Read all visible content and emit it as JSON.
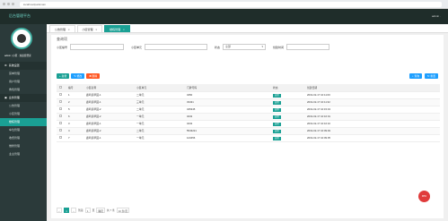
{
  "browser": {
    "url": "localhost/parkmain"
  },
  "header": {
    "logo": "后台管理平台",
    "user": "admin ·"
  },
  "sidebar": {
    "user_line": "admin | 小区 · 欢迎您登录",
    "groups": [
      {
        "label": "系统设置",
        "items": [
          "菜单管理",
          "用户管理",
          "角色管理"
        ]
      },
      {
        "label": "业务管理",
        "items": [
          "公告管理",
          "小区管理",
          "楼栋管理",
          "车位管理",
          "收费管理",
          "维修管理",
          "业主管理"
        ]
      }
    ],
    "active_item": "楼栋管理"
  },
  "tabs": [
    {
      "label": "公告管理",
      "active": false
    },
    {
      "label": "小区管理",
      "active": false
    },
    {
      "label": "楼栋管理",
      "active": true
    }
  ],
  "panel": {
    "title": "查询项",
    "search": {
      "f1_label": "小区编号",
      "f1_value": "",
      "f2_label": "小区单元",
      "f2_value": "",
      "f3_label": "状态",
      "f3_value": "全部",
      "f4_label": "创建时间",
      "f4_value": ""
    },
    "buttons": {
      "add": "新增",
      "edit": "修改",
      "delete": "删除",
      "search": "查询",
      "reset": "重置"
    }
  },
  "table": {
    "headers": [
      "",
      "编号",
      "小区名称",
      "小区单元",
      "门牌号码",
      "状态",
      "创建日期"
    ],
    "rows": [
      [
        "1",
        "鹿鸣翡翠园-1",
        "二单元",
        "3450",
        "启用",
        "2019-02-17 10:11:00"
      ],
      [
        "2",
        "鹿鸣翡翠园-1",
        "三单元",
        "33431",
        "启用",
        "2019-02-17 10:11:32"
      ],
      [
        "5",
        "鹿鸣翡翠园-2",
        "二单元",
        "345345",
        "启用",
        "2019-02-17 10:15:43"
      ],
      [
        "6",
        "鹿鸣翡翠园-2",
        "一单元",
        "3232",
        "启用",
        "2019-02-17 10:16:01"
      ],
      [
        "3",
        "鹿鸣翡翠园-1",
        "一单元",
        "3232",
        "启用",
        "2019-02-17 10:16:10"
      ],
      [
        "4",
        "鹿鸣翡翠园-2",
        "二单元",
        "5543221",
        "启用",
        "2019-02-17 10:09:49"
      ],
      [
        "7",
        "鹿鸣翡翠园-1",
        "一单元",
        "123456",
        "启用",
        "2019-02-17 10:09:35"
      ]
    ]
  },
  "pager": {
    "current": "1",
    "goto_label": "到第",
    "page_input": "1",
    "page_unit": "页",
    "confirm": "确定",
    "total": "共 7 条",
    "per_page": "10 条/页"
  },
  "float_badge": "98%",
  "colors": {
    "accent": "#1aa094",
    "sidebar": "#2b3a3a",
    "header": "#1f2d2a",
    "danger": "#ff5722",
    "info": "#1e9fff"
  }
}
